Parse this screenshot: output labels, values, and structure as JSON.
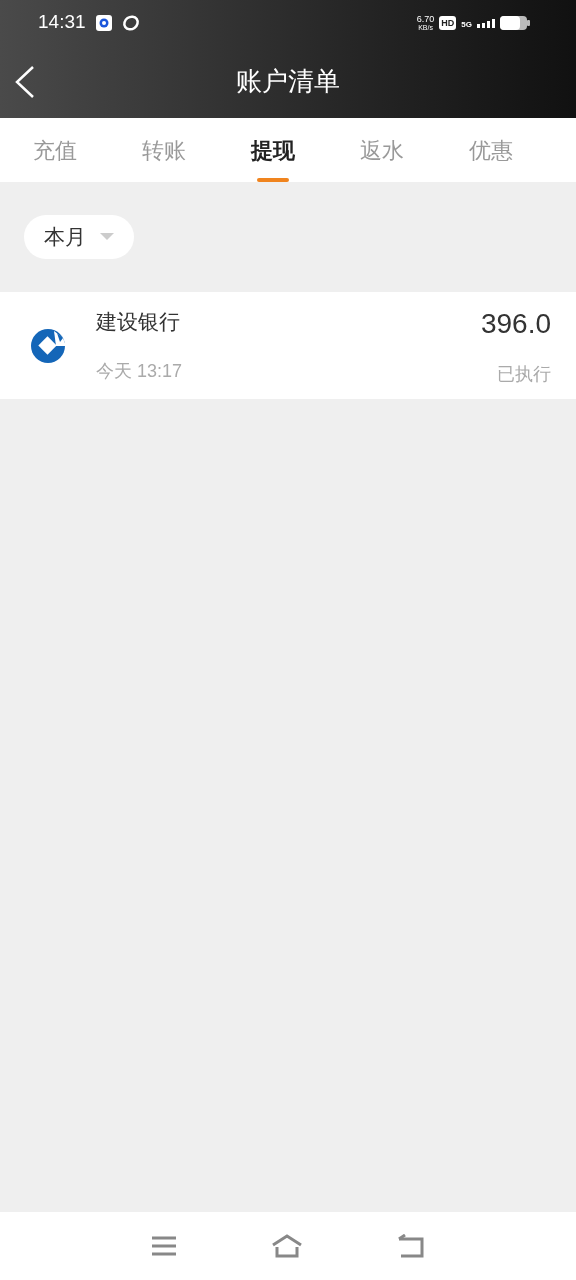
{
  "status_bar": {
    "time": "14:31",
    "net_speed": "6.70",
    "net_unit": "KB/s",
    "hd": "HD",
    "network": "5G"
  },
  "header": {
    "title": "账户清单"
  },
  "tabs": [
    {
      "label": "充值",
      "selected": false
    },
    {
      "label": "转账",
      "selected": false
    },
    {
      "label": "提现",
      "selected": true
    },
    {
      "label": "返水",
      "selected": false
    },
    {
      "label": "优惠",
      "selected": false
    }
  ],
  "filter": {
    "label": "本月"
  },
  "records": [
    {
      "bank": "建设银行",
      "time": "今天 13:17",
      "amount": "396.0",
      "status": "已执行"
    }
  ]
}
